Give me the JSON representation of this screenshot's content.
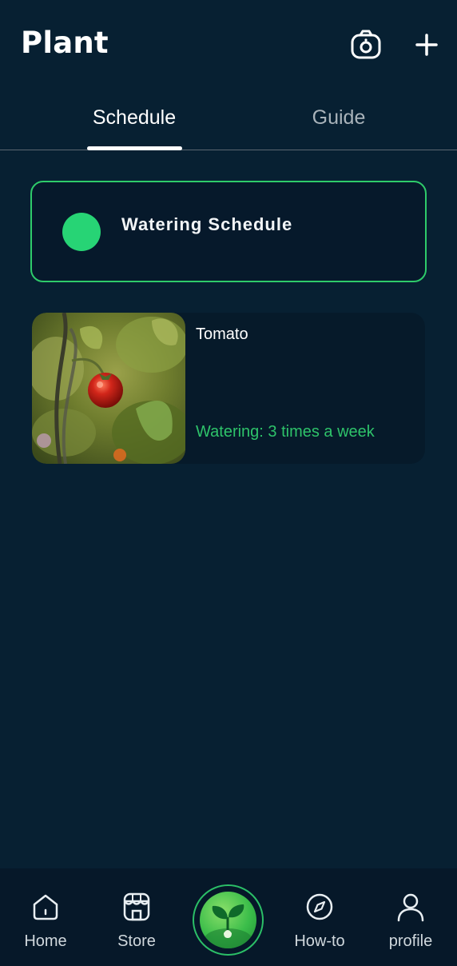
{
  "header": {
    "title": "Plant",
    "camera_icon": "camera-icon",
    "add_icon": "plus-icon"
  },
  "tabs": [
    {
      "label": "Schedule",
      "active": true
    },
    {
      "label": "Guide",
      "active": false
    }
  ],
  "schedule_card": {
    "title": "Watering Schedule",
    "dot_color": "#27d475"
  },
  "plants": [
    {
      "name": "Tomato",
      "watering": "Watering: 3 times a week",
      "image": "tomato-photo"
    }
  ],
  "bottom_nav": {
    "items": [
      {
        "label": "Home",
        "icon": "home-icon"
      },
      {
        "label": "Store",
        "icon": "store-icon"
      },
      {
        "label": "How-to",
        "icon": "compass-icon"
      },
      {
        "label": "profile",
        "icon": "user-icon"
      }
    ],
    "center_icon": "sprout-icon"
  },
  "colors": {
    "background": "#072032",
    "accent": "#2ecb6a",
    "card": "#061a2a"
  }
}
